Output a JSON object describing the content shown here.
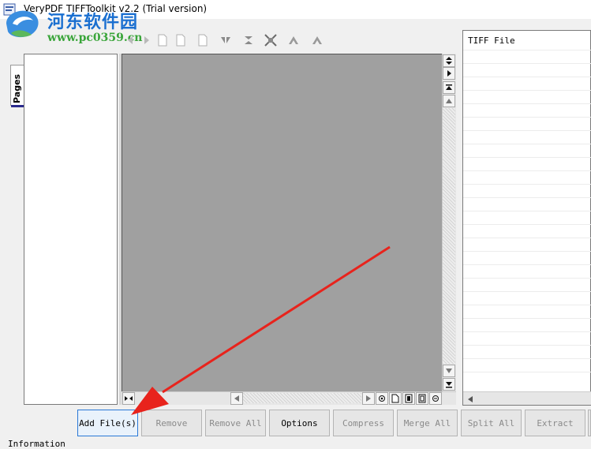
{
  "window": {
    "title": "VeryPDF TIFFToolkit v2.2 (Trial version)"
  },
  "watermark": {
    "line1": "河东软件园",
    "line2": "www.pc0359.cn"
  },
  "side_tab": {
    "label": "Pages"
  },
  "file_list": {
    "header": "TIFF File"
  },
  "buttons": {
    "add_files": "Add File(s)",
    "remove": "Remove",
    "remove_all": "Remove All",
    "options": "Options",
    "compress": "Compress",
    "merge_all": "Merge All",
    "split_all": "Split All",
    "extract": "Extract"
  },
  "footer": {
    "information_label": "Information"
  },
  "colors": {
    "annotation_arrow": "#e8231c",
    "focus_border": "#2a78d6",
    "viewer_bg": "#a0a0a0"
  },
  "toolbar_icons": [
    "prev-page-icon",
    "next-page-icon",
    "page-icon",
    "page-icon",
    "page-icon",
    "page-icon",
    "flip-horizontal-icon",
    "flip-vertical-icon",
    "fit-icon",
    "rotate-left-icon",
    "rotate-right-icon"
  ]
}
